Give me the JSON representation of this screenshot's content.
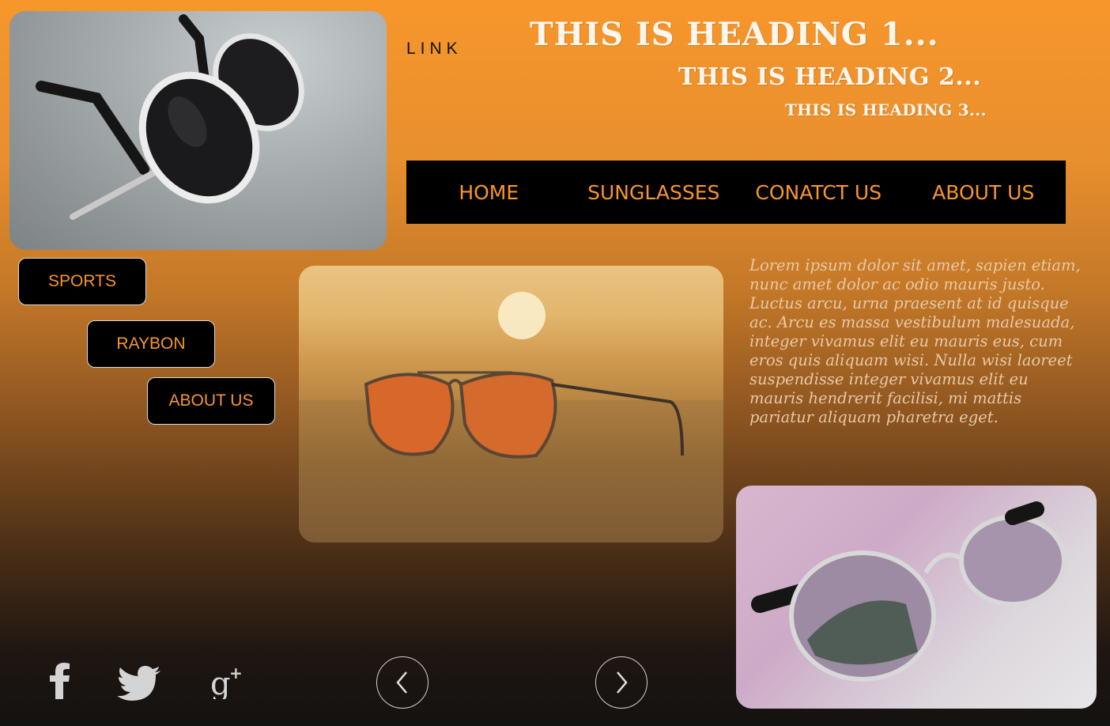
{
  "header": {
    "link": "LINK",
    "heading1": "THIS IS HEADING 1...",
    "heading2": "THIS IS HEADING 2...",
    "heading3": "THIS IS HEADING 3..."
  },
  "nav": {
    "items": [
      {
        "label": "HOME"
      },
      {
        "label": "SUNGLASSES"
      },
      {
        "label": "CONATCT US"
      },
      {
        "label": "ABOUT US"
      }
    ]
  },
  "sidebar": {
    "buttons": [
      {
        "label": "SPORTS"
      },
      {
        "label": "RAYBON"
      },
      {
        "label": "ABOUT US"
      }
    ]
  },
  "main": {
    "paragraph": "Lorem ipsum dolor sit amet, sapien etiam, nunc amet dolor ac odio mauris justo. Luctus arcu, urna praesent at id quisque ac. Arcu es massa vestibulum malesuada, integer vivamus elit eu mauris eus, cum eros quis aliquam wisi. Nulla wisi laoreet suspendisse integer vivamus elit eu mauris hendrerit facilisi, mi mattis pariatur aliquam pharetra eget."
  },
  "social": {
    "icons": [
      "facebook-icon",
      "twitter-icon",
      "google-plus-icon"
    ]
  },
  "colors": {
    "accent": "#f7962b",
    "nav_bg": "#000000"
  }
}
